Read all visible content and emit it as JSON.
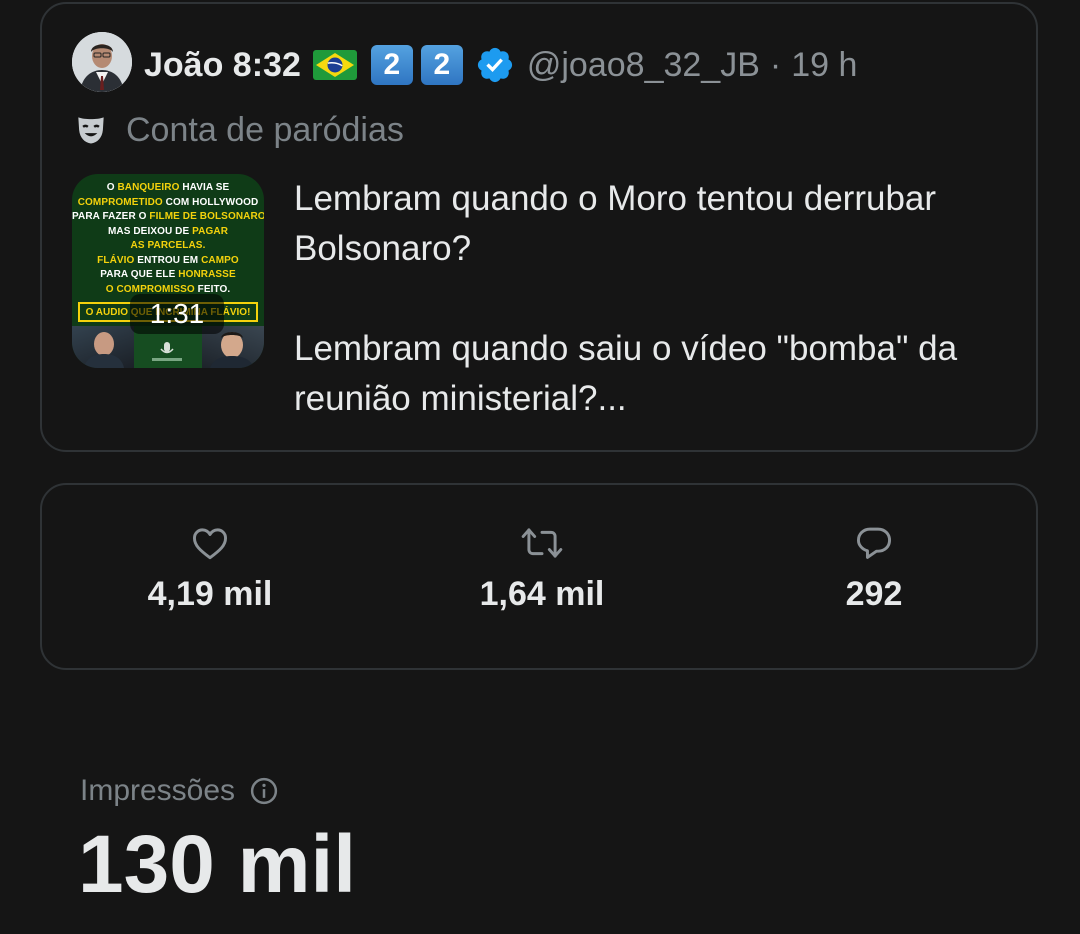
{
  "tweet": {
    "display_name": "João 8:32",
    "flag_icon": "brazil-flag-icon",
    "badges": [
      "2",
      "2"
    ],
    "verified_icon": "verified-badge-icon",
    "handle": "@joao8_32_JB",
    "separator": "·",
    "time": "19 h",
    "parody_label": "Conta de paródias",
    "paragraphs": [
      "Lembram quando o Moro tentou derrubar Bolsonaro?",
      "Lembram quando saiu o vídeo \"bomba\" da reunião ministerial?..."
    ],
    "video": {
      "duration": "1:31",
      "thumbnail_lines": [
        [
          {
            "t": "O ",
            "y": false
          },
          {
            "t": "BANQUEIRO",
            "y": true
          },
          {
            "t": " HAVIA SE",
            "y": false
          }
        ],
        [
          {
            "t": "COMPROMETIDO",
            "y": true
          },
          {
            "t": " COM HOLLYWOOD",
            "y": false
          }
        ],
        [
          {
            "t": "PARA FAZER O ",
            "y": false
          },
          {
            "t": "FILME DE BOLSONARO",
            "y": true
          },
          {
            "t": ",",
            "y": false
          }
        ],
        [
          {
            "t": "MAS DEIXOU DE ",
            "y": false
          },
          {
            "t": "PAGAR",
            "y": true
          }
        ],
        [
          {
            "t": "AS PARCELAS.",
            "y": true
          }
        ],
        [
          {
            "t": "FLÁVIO",
            "y": true
          },
          {
            "t": " ENTROU EM ",
            "y": false
          },
          {
            "t": "CAMPO",
            "y": true
          }
        ],
        [
          {
            "t": "PARA QUE ELE ",
            "y": false
          },
          {
            "t": "HONRASSE",
            "y": true
          }
        ],
        [
          {
            "t": "O COMPROMISSO",
            "y": true
          },
          {
            "t": " FEITO.",
            "y": false
          }
        ]
      ],
      "banner_text": "O AUDIO QUE INCRIMINA FLÁVIO!"
    }
  },
  "stats": {
    "likes": {
      "icon": "heart-icon",
      "count": "4,19 mil"
    },
    "reposts": {
      "icon": "repost-icon",
      "count": "1,64 mil"
    },
    "replies": {
      "icon": "reply-icon",
      "count": "292"
    }
  },
  "impressions": {
    "label": "Impressões",
    "info_icon": "info-icon",
    "value": "130 mil"
  },
  "colors": {
    "background": "#151515",
    "border": "#2f3336",
    "text": "#e7e9ea",
    "muted": "#7c8388",
    "verified": "#1d9bf0",
    "thumb_yellow": "#f4d20c"
  }
}
